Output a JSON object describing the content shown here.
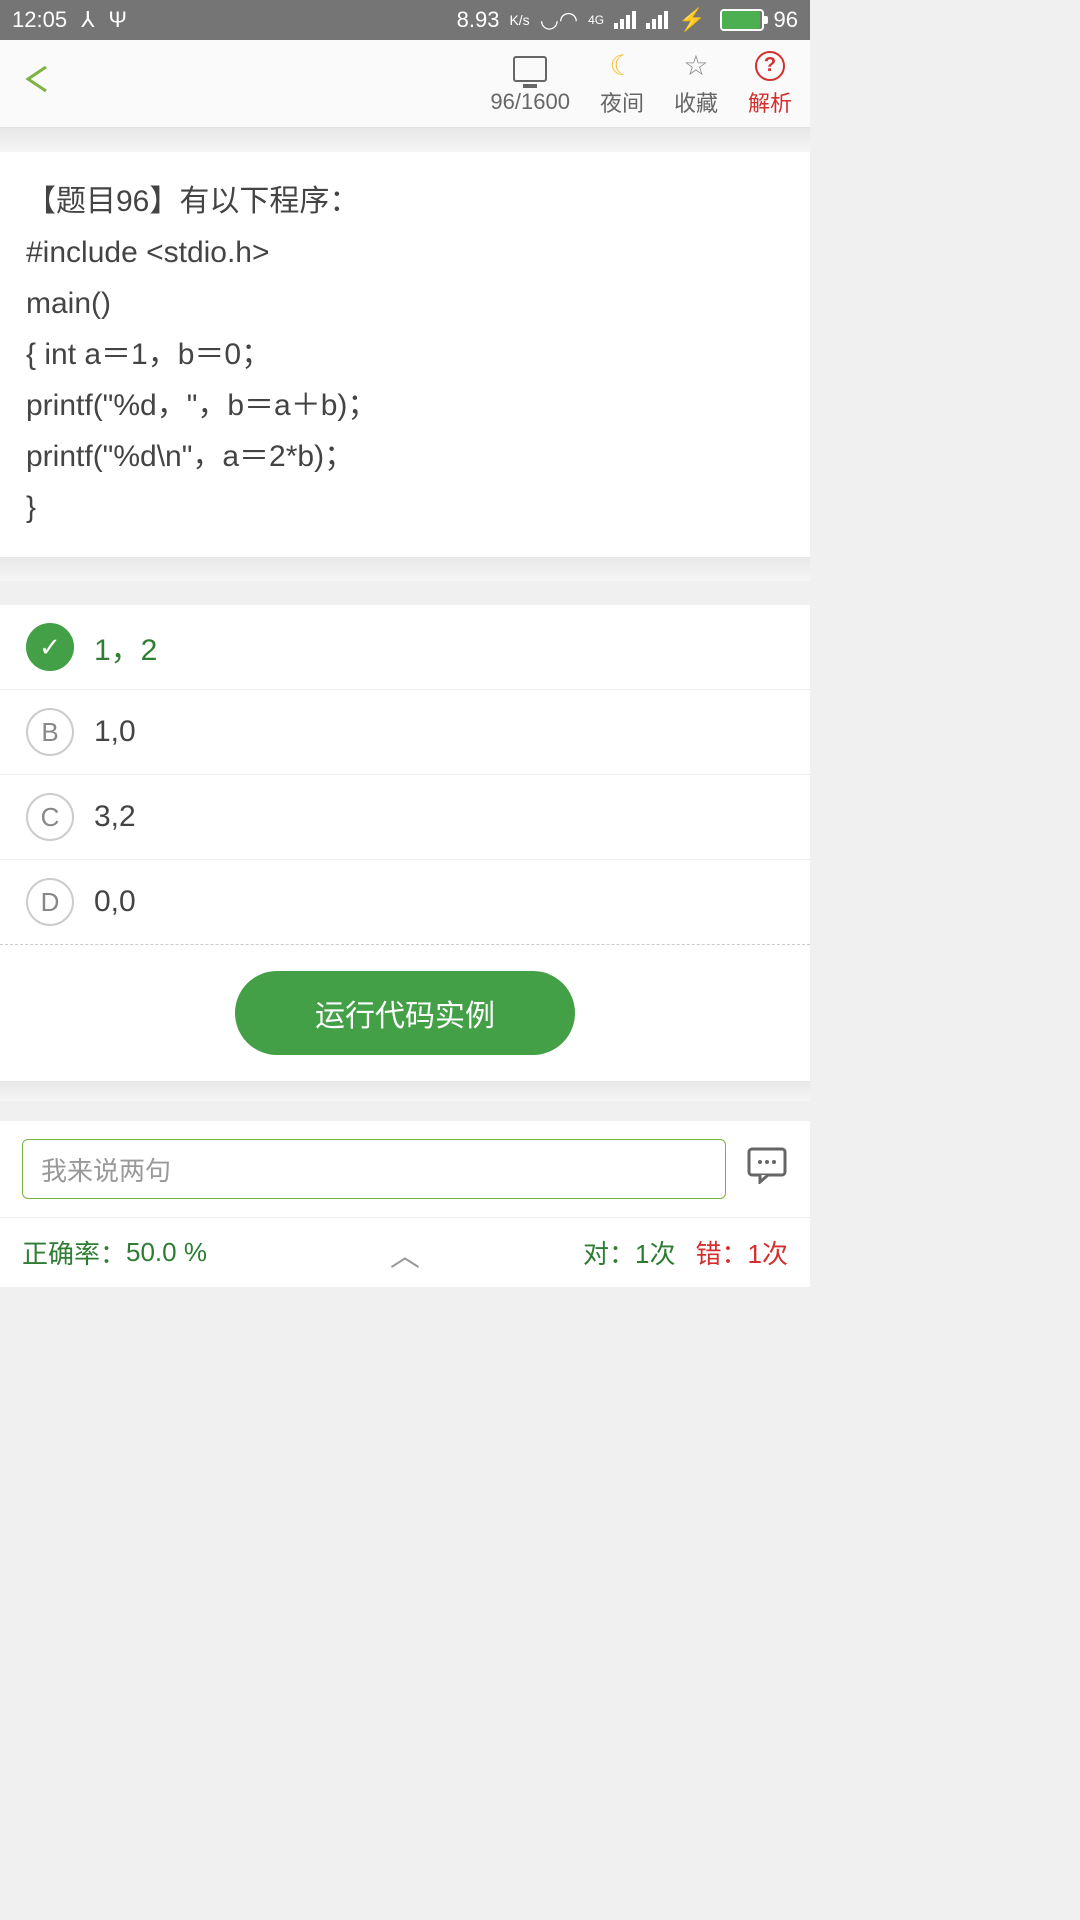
{
  "status": {
    "time": "12:05",
    "speed": "8.93",
    "speed_unit": "K/s",
    "net_label": "4G",
    "battery_pct": "96"
  },
  "toolbar": {
    "progress": "96/1600",
    "night_label": "夜间",
    "favorite_label": "收藏",
    "analysis_label": "解析"
  },
  "question": {
    "title_line": "【题目96】有以下程序：",
    "code_l1": "#include  <stdio.h>",
    "code_l2": "main()",
    "code_l3": "{    int  a＝1，b＝0；",
    "code_l4": "       printf(\"%d，\"，b＝a＋b)；",
    "code_l5": "       printf(\"%d\\n\"，a＝2*b)；",
    "code_l6": "}"
  },
  "options": [
    {
      "letter": "✓",
      "text": "1，2",
      "correct": true
    },
    {
      "letter": "B",
      "text": "1,0",
      "correct": false
    },
    {
      "letter": "C",
      "text": "3,2",
      "correct": false
    },
    {
      "letter": "D",
      "text": "0,0",
      "correct": false
    }
  ],
  "buttons": {
    "run_code": "运行代码实例"
  },
  "comment": {
    "placeholder": "我来说两句"
  },
  "stats": {
    "accuracy_label": "正确率：",
    "accuracy_value": "50.0 %",
    "correct_label": "对：",
    "correct_value": "1次",
    "wrong_label": "错：",
    "wrong_value": "1次"
  }
}
